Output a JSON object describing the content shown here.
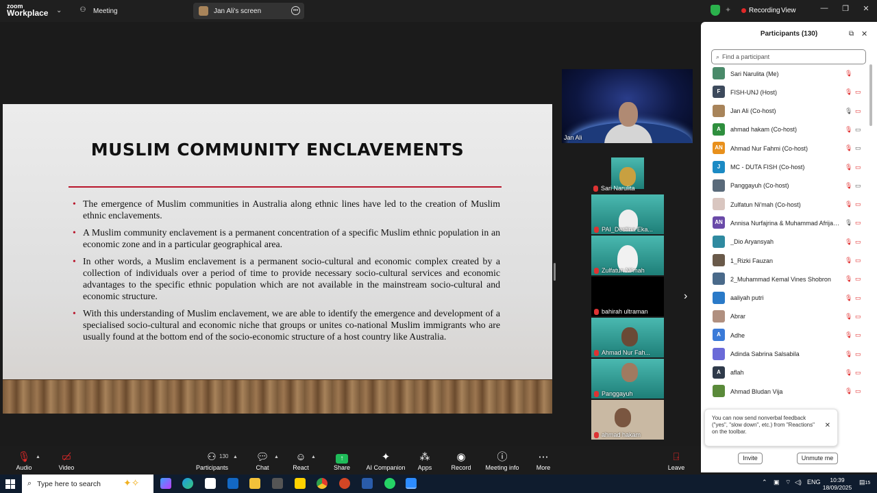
{
  "titlebar": {
    "logo_small": "zoom",
    "logo_big": "Workplace",
    "tab_meeting": "Meeting",
    "tab_share": "Jan Ali's screen",
    "recording": "Recording",
    "view": "View"
  },
  "slide": {
    "title": "MUSLIM COMMUNITY ENCLAVEMENTS",
    "bullets": [
      "The emergence of Muslim communities in Australia along ethnic lines have led to the creation of Muslim ethnic enclavements.",
      "A Muslim community enclavement  is a permanent concentration of a specific Muslim ethnic population in an economic zone and in a particular geographical area.",
      "In other words, a Muslim enclavement is a permanent socio-cultural and economic complex created by a collection of individuals over a period of time to provide necessary socio-cultural services and economic advantages to the specific ethnic population which are not available in the mainstream socio-cultural and economic structure.",
      "With this understanding of Muslim enclavement, we are able to identify the emergence and development of a specialised socio-cultural and economic niche that groups or unites co-national Muslim immigrants who are usually found at the bottom end of the socio-economic structure of a host country like Australia."
    ]
  },
  "speaker": {
    "name": "Jan Ali"
  },
  "thumbnails": [
    "Sari Narulita",
    "PAI_Destina Eka...",
    "Zulfatun Ni'mah",
    "bahirah ultraman",
    "Ahmad Nur Fah...",
    "Panggayuh",
    "ahmad hakam"
  ],
  "panel": {
    "title": "Participants (130)",
    "search_placeholder": "Find a participant",
    "participants": [
      {
        "name": "Sari Narulita (Me)",
        "initials": "",
        "color": "#4a8a6a"
      },
      {
        "name": "FISH-UNJ (Host)",
        "initials": "F",
        "color": "#3d4a5c"
      },
      {
        "name": "Jan Ali (Co-host)",
        "initials": "",
        "color": "#a8845a"
      },
      {
        "name": "ahmad hakam (Co-host)",
        "initials": "A",
        "color": "#2f8f3e"
      },
      {
        "name": "Ahmad Nur Fahmi (Co-host)",
        "initials": "AN",
        "color": "#e8901c"
      },
      {
        "name": "MC - DUTA FISH (Co-host)",
        "initials": "J",
        "color": "#1b8ac4"
      },
      {
        "name": "Panggayuh (Co-host)",
        "initials": "",
        "color": "#5a6a7a"
      },
      {
        "name": "Zulfatun Ni'mah (Co-host)",
        "initials": "",
        "color": "#d9c6c0"
      },
      {
        "name": "Annisa Nurfajrina & Muhammad Afrijalu...",
        "initials": "AN",
        "color": "#6a4aa8"
      },
      {
        "name": "_Dio Aryansyah",
        "initials": "",
        "color": "#2f8aa0"
      },
      {
        "name": "1_Rizki Fauzan",
        "initials": "",
        "color": "#6a5a4a"
      },
      {
        "name": "2_Muhammad Kemal Vines Shobron",
        "initials": "",
        "color": "#4a6a8a"
      },
      {
        "name": "aaliyah putri",
        "initials": "",
        "color": "#2a7ac8"
      },
      {
        "name": "Abrar",
        "initials": "",
        "color": "#b09080"
      },
      {
        "name": "Adhe",
        "initials": "A",
        "color": "#3a7ad8"
      },
      {
        "name": "Adinda Sabrina Salsabila",
        "initials": "",
        "color": "#6a6ad8"
      },
      {
        "name": "aflah",
        "initials": "A",
        "color": "#2f3a4a"
      },
      {
        "name": "Ahmad Bludan Vija",
        "initials": "",
        "color": "#5a8a3a"
      }
    ],
    "toast": "You can now send nonverbal feedback (\"yes\", \"slow down\", etc.) from \"Reactions\" on the toolbar.",
    "invite": "Invite",
    "unmute": "Unmute me"
  },
  "toolbar": {
    "audio": "Audio",
    "video": "Video",
    "participants": "Participants",
    "participants_count": "130",
    "chat": "Chat",
    "react": "React",
    "share": "Share",
    "ai": "AI Companion",
    "apps": "Apps",
    "record": "Record",
    "info": "Meeting info",
    "more": "More",
    "leave": "Leave"
  },
  "taskbar": {
    "search": "Type here to search",
    "lang": "ENG",
    "time": "10:39",
    "date": "18/09/2025",
    "notif_count": "15"
  }
}
